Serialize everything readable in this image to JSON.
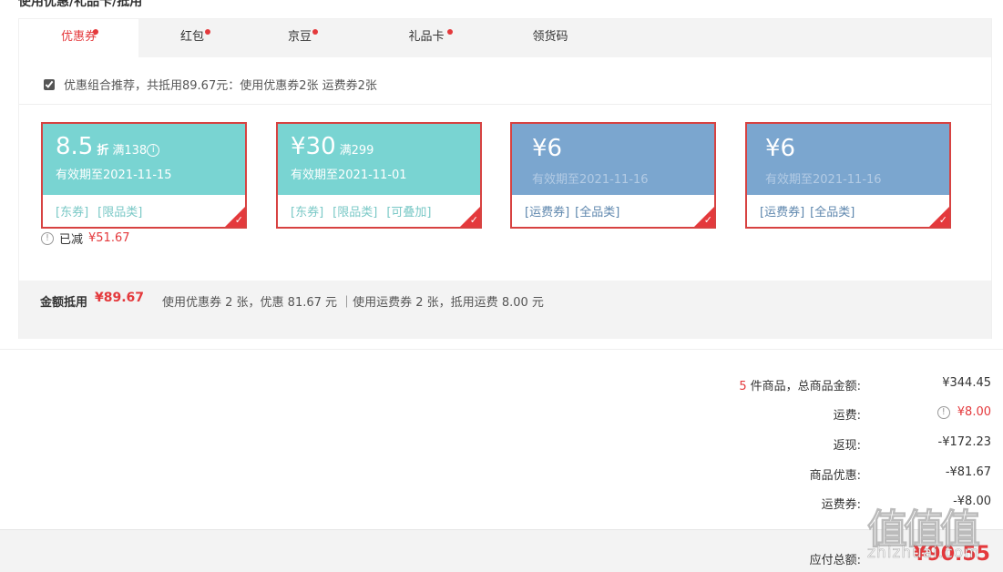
{
  "section": {
    "title": "使用优惠/礼品卡/抵用 ^"
  },
  "tabs": [
    {
      "label": "优惠券",
      "dot": true,
      "active": true
    },
    {
      "label": "红包",
      "dot": true,
      "active": false
    },
    {
      "label": "京豆",
      "dot": true,
      "active": false
    },
    {
      "label": "礼品卡",
      "dot": true,
      "active": false
    },
    {
      "label": "领货码",
      "dot": false,
      "active": false
    }
  ],
  "combo": {
    "checked": true,
    "text": "优惠组合推荐，共抵用89.67元：使用优惠券2张 运费券2张"
  },
  "coupons": [
    {
      "amount": "8.5",
      "unit": "折",
      "condition": "满138",
      "info_icon": "info-icon",
      "validity": "有效期至2021-11-15",
      "tags": [
        "[东券]",
        "[限品类]"
      ],
      "color": "#79d4d2",
      "checked": true
    },
    {
      "amount": "¥30",
      "unit": "",
      "condition": "满299",
      "validity": "有效期至2021-11-01",
      "tags": [
        "[东券]",
        "[限品类]",
        "[可叠加]"
      ],
      "color": "#79d4d2",
      "checked": true
    },
    {
      "amount": "¥6",
      "unit": "",
      "condition": "",
      "validity": "有效期至2021-11-16",
      "tags": [
        "[运费券]",
        "[全品类]"
      ],
      "color": "#7ba6cf",
      "checked": true
    },
    {
      "amount": "¥6",
      "unit": "",
      "condition": "",
      "validity": "有效期至2021-11-16",
      "tags": [
        "[运费券]",
        "[全品类]"
      ],
      "color": "#7ba6cf",
      "checked": true
    }
  ],
  "reduced": {
    "label": "已减",
    "value": "¥51.67"
  },
  "summary": {
    "label": "金额抵用",
    "amount": "¥89.67",
    "detail": "使用优惠券 2 张，优惠 81.67 元 ｜使用运费券 2 张，抵用运费 8.00 元"
  },
  "prices": {
    "count": "5",
    "goods_label": "件商品，总商品金额:",
    "goods_value": "¥344.45",
    "freight_label": "运费:",
    "freight_value": "¥8.00",
    "cashback_label": "返现:",
    "cashback_value": "-¥172.23",
    "discount_label": "商品优惠:",
    "discount_value": "-¥81.67",
    "freight_coupon_label": "运费券:",
    "freight_coupon_value": "-¥8.00"
  },
  "total": {
    "label": "应付总额:",
    "value": "¥90.55"
  },
  "watermark": {
    "glyphs": "值值值",
    "text": "zhizhuai.com"
  },
  "colors": {
    "accent": "#e4393c",
    "teal": "#79d4d2",
    "blue": "#7ba6cf",
    "freight_orange": "#e4393c"
  }
}
